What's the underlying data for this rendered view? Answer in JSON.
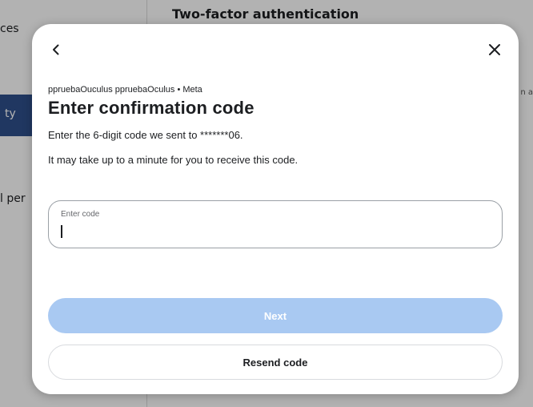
{
  "background": {
    "title": "Two-factor authentication",
    "sidebar": {
      "item_top": "ces",
      "item_selected": "ty",
      "item_lower": "l per"
    },
    "right_fragment": "n a"
  },
  "modal": {
    "back_icon": "chevron-left-icon",
    "close_icon": "close-icon",
    "account_line": "ppruebaOuculus ppruebaOculus • Meta",
    "title": "Enter confirmation code",
    "description_1": "Enter the 6-digit code we sent to *******06.",
    "description_2": "It may take up to a minute for you to receive this code.",
    "code_field": {
      "label": "Enter code",
      "value": ""
    },
    "next_label": "Next",
    "resend_label": "Resend code"
  },
  "colors": {
    "next_disabled_bg": "#a9c9f2",
    "text_primary": "#1c1e21",
    "selected_sidebar": "#2d4f8a"
  }
}
